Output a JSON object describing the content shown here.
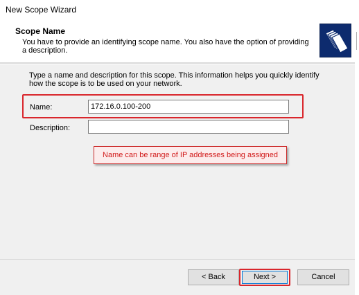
{
  "window": {
    "title": "New Scope Wizard"
  },
  "header": {
    "title": "Scope Name",
    "description": "You have to provide an identifying scope name. You also have the option of providing a description.",
    "icon": "folder-wizard-icon"
  },
  "body": {
    "intro": "Type a name and description for this scope. This information helps you quickly identify how the scope is to be used on your network.",
    "name_label": "Name:",
    "name_value": "172.16.0.100-200",
    "description_label": "Description:",
    "description_value": ""
  },
  "annotation": {
    "text": "Name can be range of IP addresses being assigned",
    "color": "#d9262c"
  },
  "buttons": {
    "back": "< Back",
    "next": "Next >",
    "cancel": "Cancel"
  }
}
